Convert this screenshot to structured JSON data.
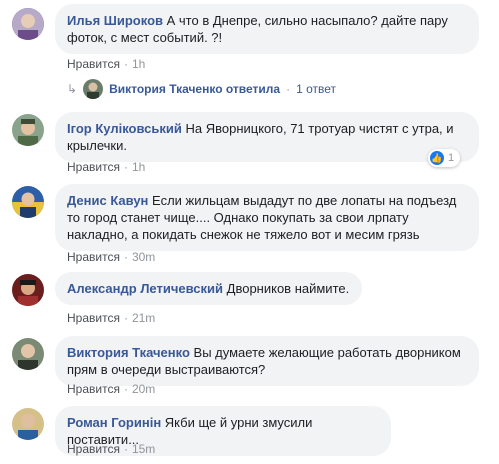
{
  "comments": [
    {
      "author": "Илья Широков",
      "text": "А что в Днепре, сильно насыпало? дайте пару фоток, с мест событий. ?!",
      "like": "Нравится",
      "time": "1h",
      "avatar_color": "#7a5a8e"
    },
    {
      "author": "Ігор Куліковський",
      "text": "На Яворницкого, 71 тротуар чистят с утра, и крылечки.",
      "like": "Нравится",
      "time": "1h",
      "avatar_color": "#5f7d63",
      "reactions": "1"
    },
    {
      "author": "Денис Кавун",
      "text": "Если жильцам выдадут по две лопаты на подъезд то город станет чище.... Однако покупать за свои лрпату накладно, а покидать снежок не тяжело вот и месим грязь",
      "like": "Нравится",
      "time": "30m",
      "avatar_color": "#c9a23a"
    },
    {
      "author": "Александр Летичевский",
      "text": "Дворников наймите.",
      "like": "Нравится",
      "time": "21m",
      "avatar_color": "#8b2a2a"
    },
    {
      "author": "Виктория Ткаченко",
      "text": "Вы думаете желающие работать дворником прям в очереди выстраиваются?",
      "like": "Нравится",
      "time": "20m",
      "avatar_color": "#4a5a48"
    },
    {
      "author": "Роман Горинін",
      "text": "Якби ще й урни змусили поставити...",
      "like": "Нравится",
      "time": "15m",
      "avatar_color": "#3a6fb0"
    }
  ],
  "reply_summary": {
    "text": "Виктория Ткаченко ответила",
    "dot": "·",
    "count": "1 ответ",
    "arrow": "↳"
  },
  "dot": "·",
  "like_icon": "👍"
}
